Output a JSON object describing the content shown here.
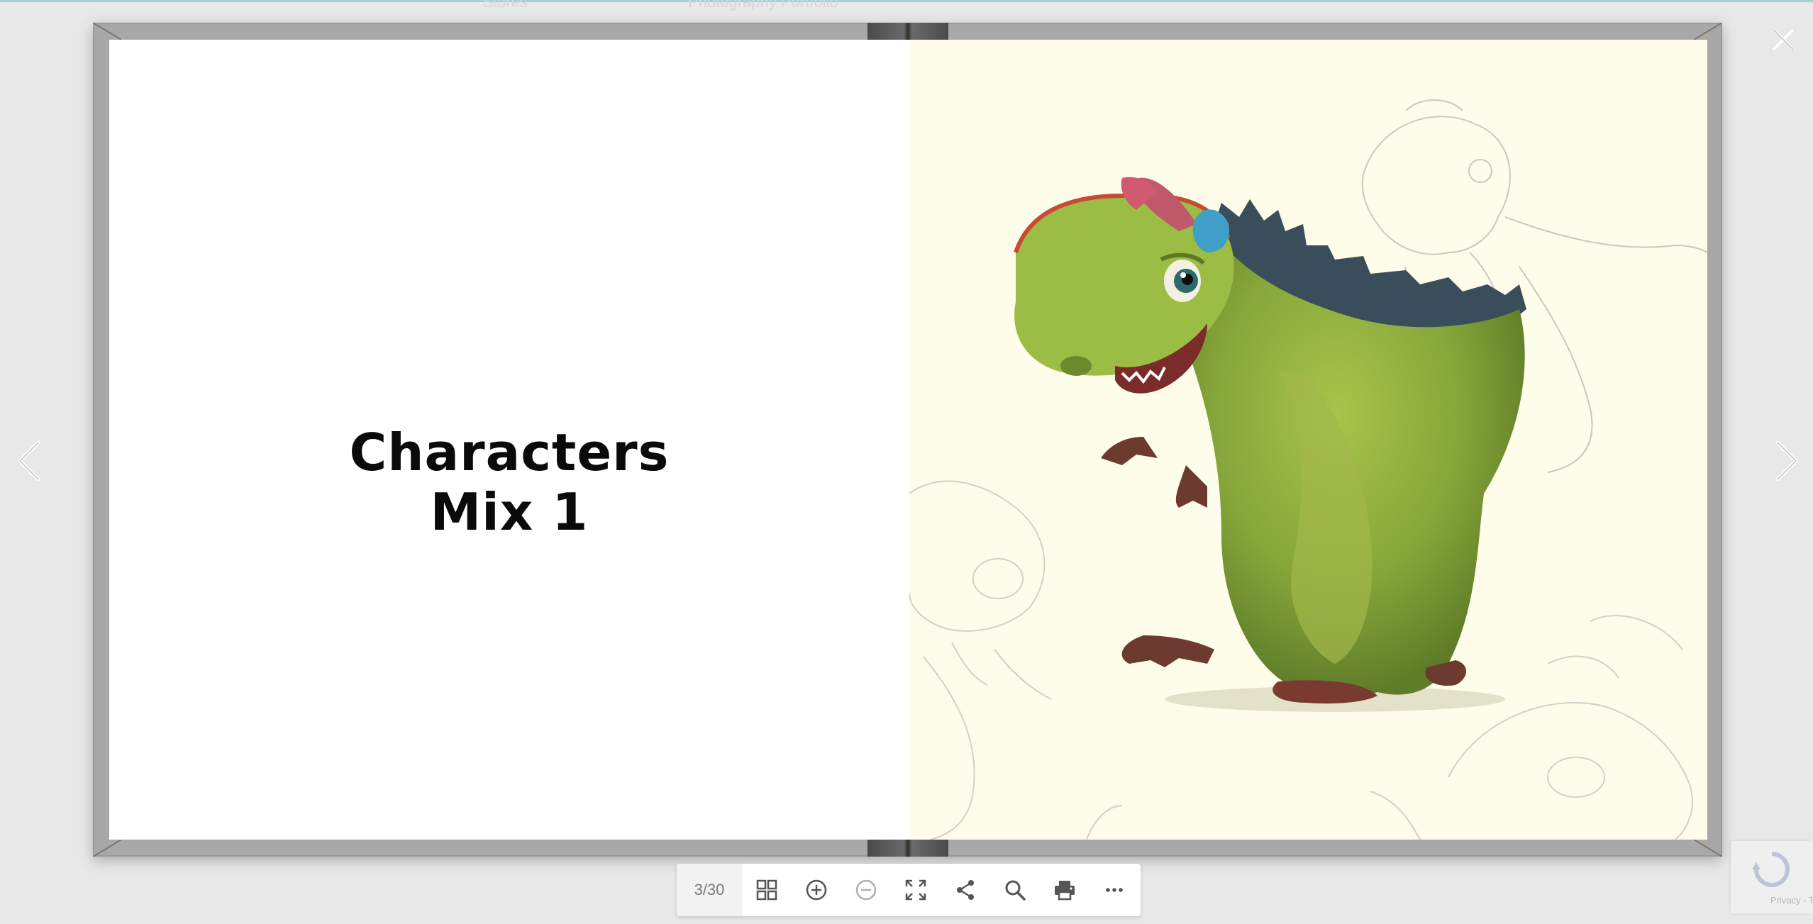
{
  "background_nav": {
    "item_1": "Stores",
    "item_2": "Photography Portfolio"
  },
  "book": {
    "left_page": {
      "title_line_1": "Characters",
      "title_line_2": "Mix 1"
    },
    "right_page": {
      "image": "dinosaur-character-illustration"
    }
  },
  "controls": {
    "close": "close-icon",
    "prev": "chevron-left-icon",
    "next": "chevron-right-icon"
  },
  "toolbar": {
    "page_counter": "3/30",
    "buttons": [
      "grid-icon",
      "zoom-in-icon",
      "zoom-out-icon",
      "fullscreen-icon",
      "share-icon",
      "search-icon",
      "print-icon",
      "more-icon"
    ]
  },
  "recaptcha": {
    "terms": "Privacy - Terms"
  },
  "colors": {
    "background": "#e8e8e8",
    "toolbar_icon": "#555555",
    "disabled_icon": "#b0b0b0",
    "right_page_bg": "#fdfde9"
  }
}
